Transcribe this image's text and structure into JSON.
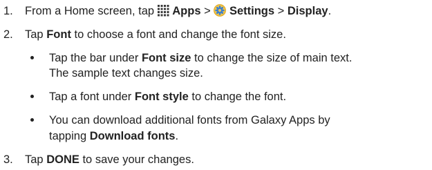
{
  "steps": [
    {
      "number": "1.",
      "text": {
        "prefix": "From a Home screen, tap",
        "apps": "Apps",
        "sep1": ">",
        "settings": "Settings",
        "sep2": ">",
        "display": "Display",
        "end": "."
      }
    },
    {
      "number": "2.",
      "text": {
        "prefix": "Tap",
        "bold": "Font",
        "suffix": "to choose a font and change the font size."
      },
      "bullets": [
        {
          "line1_prefix": "Tap the bar under",
          "line1_bold": "Font size",
          "line1_suffix": "to change the size of main text.",
          "line2": "The sample text changes size."
        },
        {
          "prefix": "Tap a font under",
          "bold": "Font style",
          "suffix": "to change the font."
        },
        {
          "line1": "You can download additional fonts from Galaxy Apps by",
          "line2_prefix": "tapping",
          "line2_bold": "Download fonts",
          "line2_end": "."
        }
      ]
    },
    {
      "number": "3.",
      "text": {
        "prefix": "Tap",
        "bold": "DONE",
        "suffix": "to save your changes."
      }
    }
  ],
  "icons": {
    "apps": "apps-grid-icon",
    "settings": "settings-gear-icon"
  },
  "colors": {
    "text": "#222222",
    "settings_icon_gold": "#d9a21b",
    "settings_icon_blue": "#3a7fd0"
  }
}
